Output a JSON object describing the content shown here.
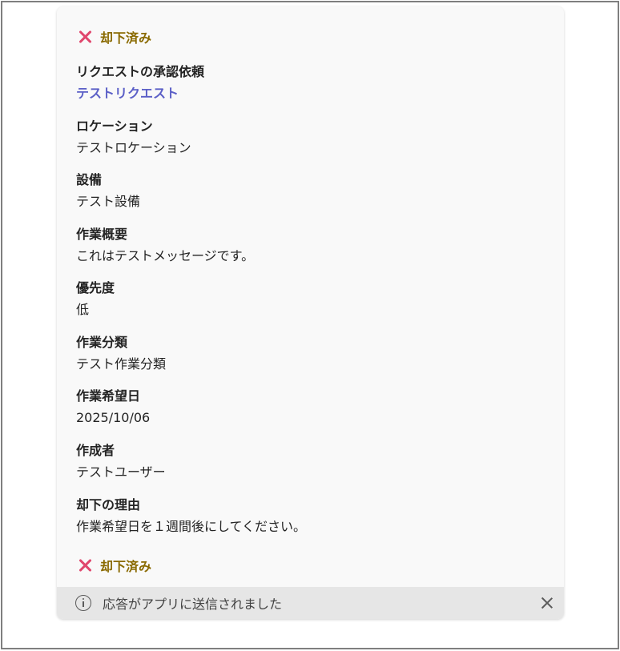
{
  "status": {
    "label": "却下済み",
    "icon": "close-x-icon",
    "color": "#8a6a00",
    "icon_color": "#e0476d"
  },
  "fields": [
    {
      "label": "リクエストの承認依頼",
      "value": "テストリクエスト",
      "is_link": true
    },
    {
      "label": "ロケーション",
      "value": "テストロケーション"
    },
    {
      "label": "設備",
      "value": "テスト設備"
    },
    {
      "label": "作業概要",
      "value": "これはテストメッセージです。"
    },
    {
      "label": "優先度",
      "value": "低"
    },
    {
      "label": "作業分類",
      "value": "テスト作業分類"
    },
    {
      "label": "作業希望日",
      "value": "2025/10/06"
    },
    {
      "label": "作成者",
      "value": "テストユーザー"
    },
    {
      "label": "却下の理由",
      "value": "作業希望日を１週間後にしてください。"
    }
  ],
  "status_bottom": {
    "label": "却下済み"
  },
  "footer": {
    "message": "応答がアプリに送信されました",
    "info_icon": "info-icon",
    "close_icon": "close-icon"
  },
  "colors": {
    "link": "#5b5fc7",
    "card_bg": "#f9f9f9",
    "footer_bg": "#e6e6e6"
  }
}
